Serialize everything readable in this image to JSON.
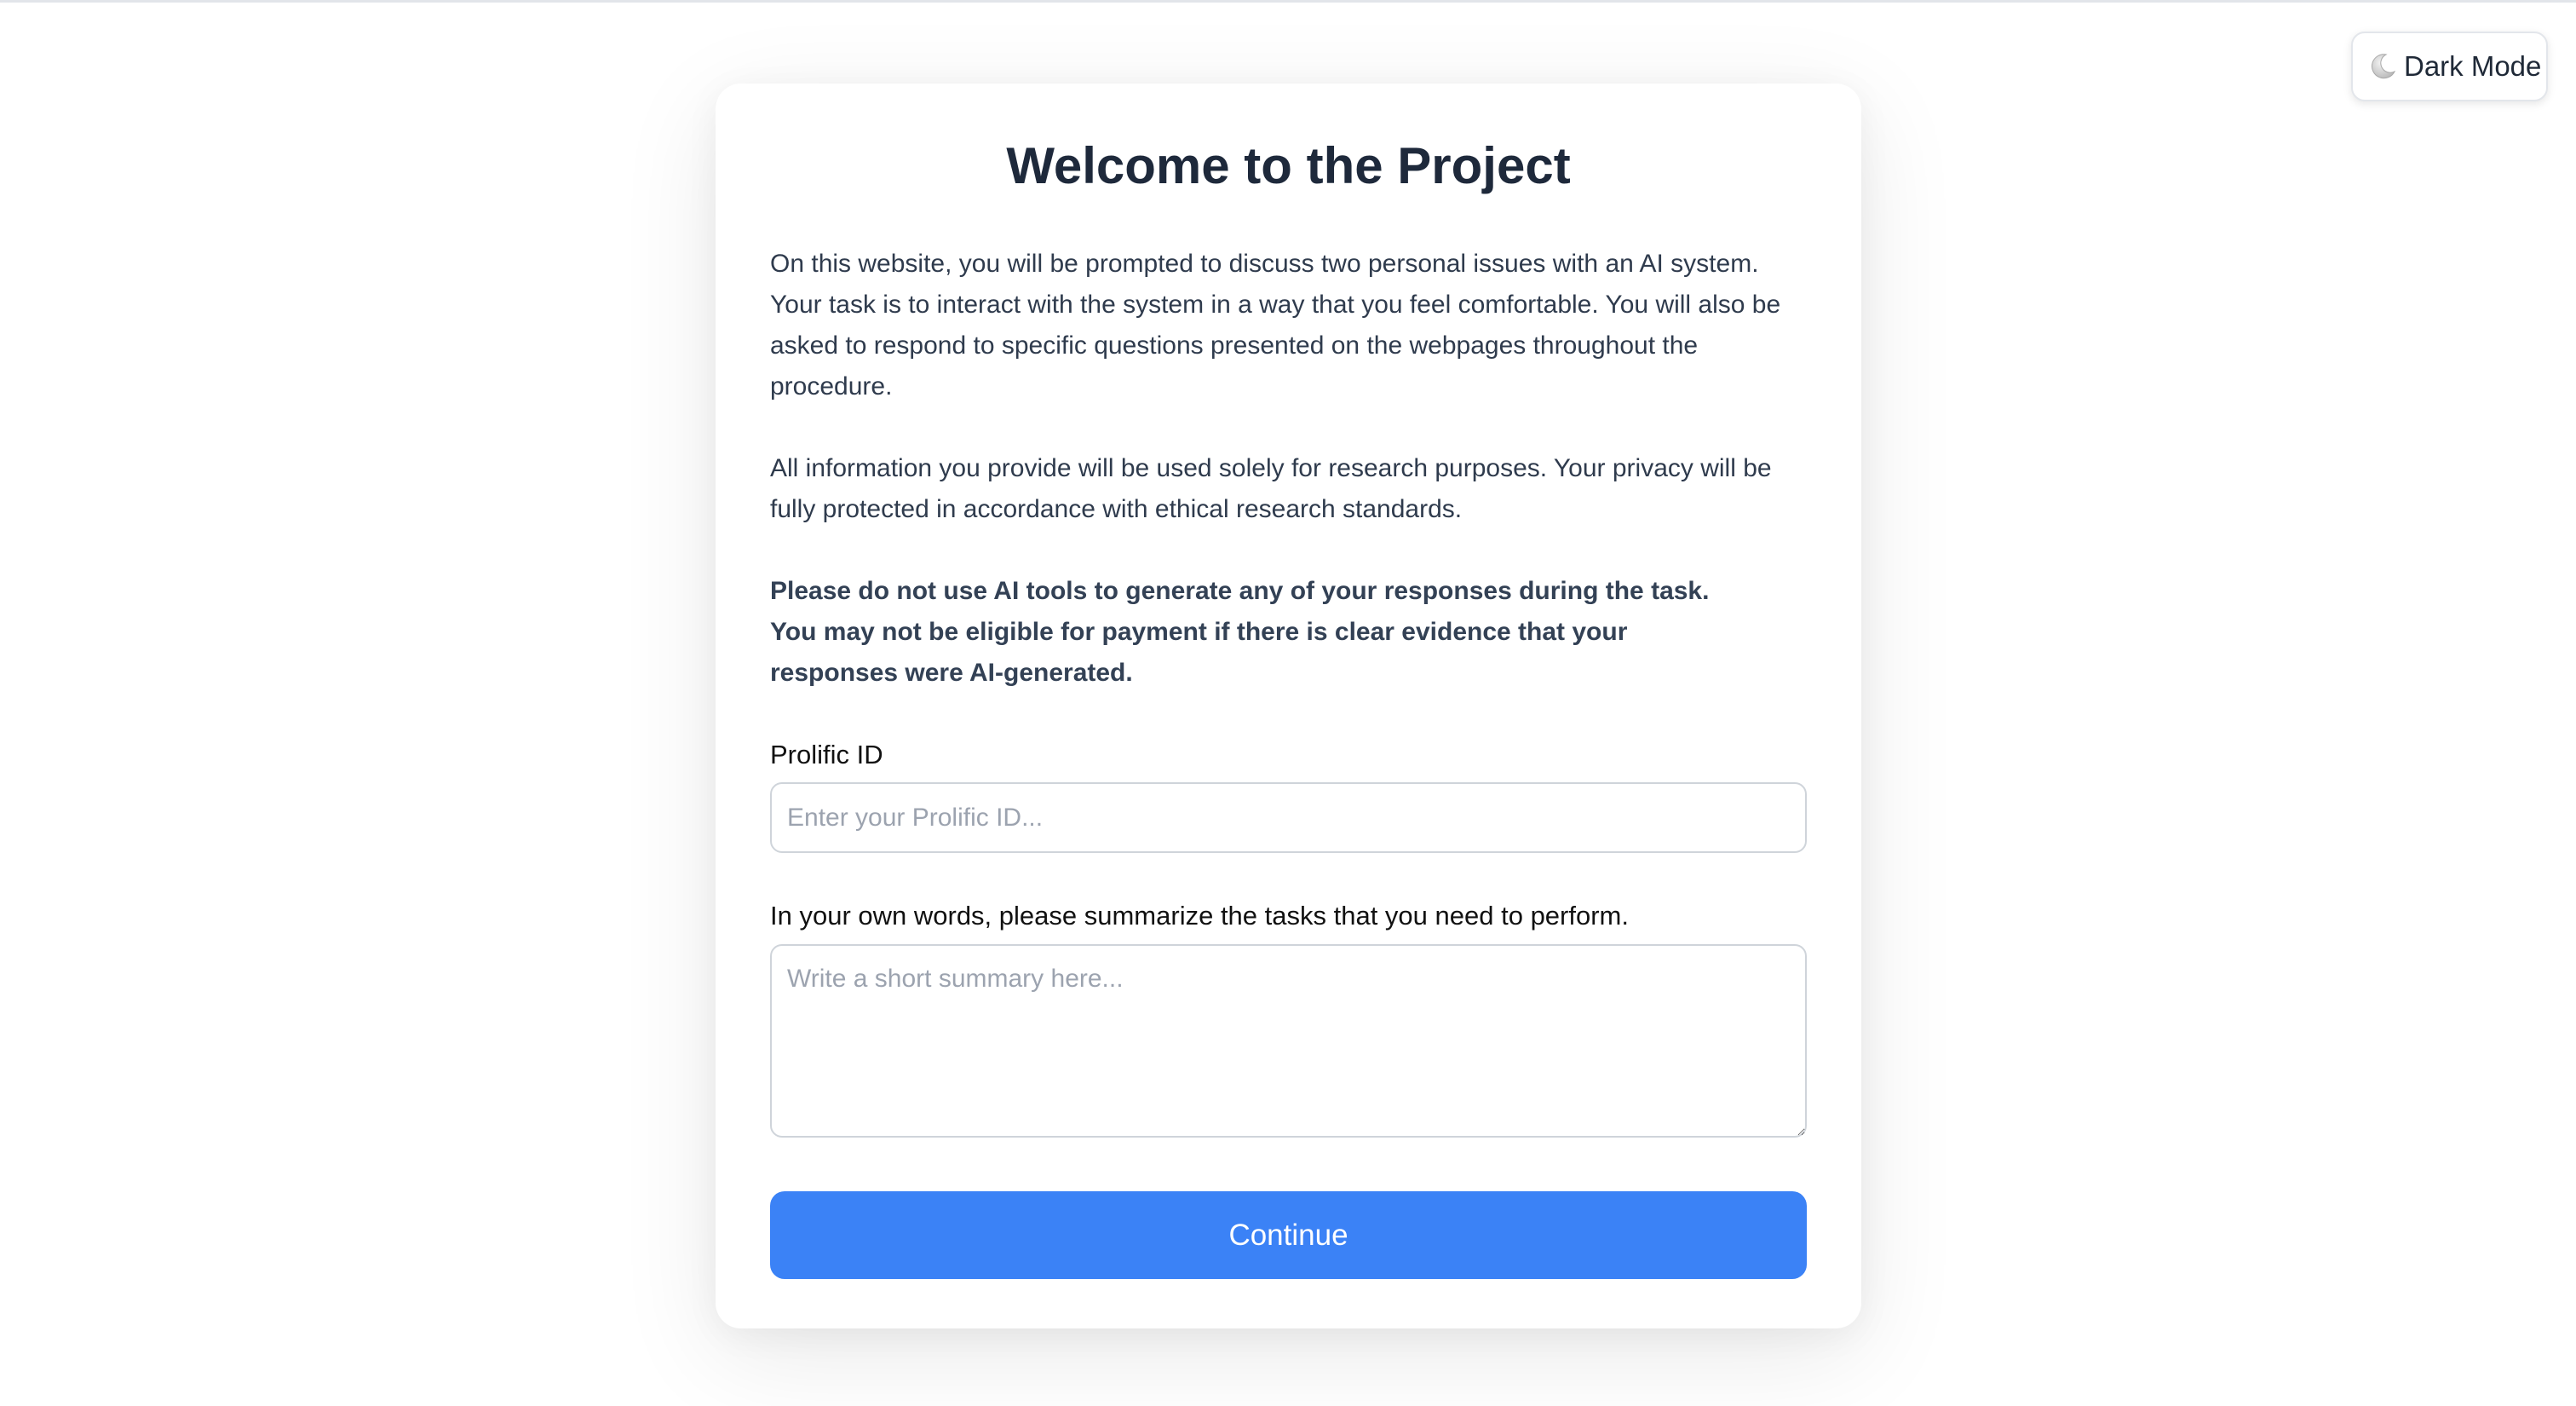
{
  "theme_toggle": {
    "icon": "moon-icon",
    "label": "Dark Mode"
  },
  "card": {
    "title": "Welcome to the Project",
    "paragraphs": [
      "On this website, you will be prompted to discuss two personal issues with an AI system. Your task is to interact with the system in a way that you feel comfortable. You will also be asked to respond to specific questions presented on the webpages throughout the procedure.",
      "All information you provide will be used solely for research purposes. Your privacy will be fully protected in accordance with ethical research standards.",
      "Please do not use AI tools to generate any of your responses during the task. You may not be eligible for payment if there is clear evidence that your responses were AI-generated."
    ],
    "prolific_id": {
      "label": "Prolific ID",
      "placeholder": "Enter your Prolific ID...",
      "value": ""
    },
    "summary": {
      "label": "In your own words, please summarize the tasks that you need to perform.",
      "placeholder": "Write a short summary here...",
      "value": ""
    },
    "continue_label": "Continue"
  },
  "colors": {
    "accent": "#3b82f6",
    "title_text": "#1e293b",
    "body_text": "#2f3b4d"
  }
}
